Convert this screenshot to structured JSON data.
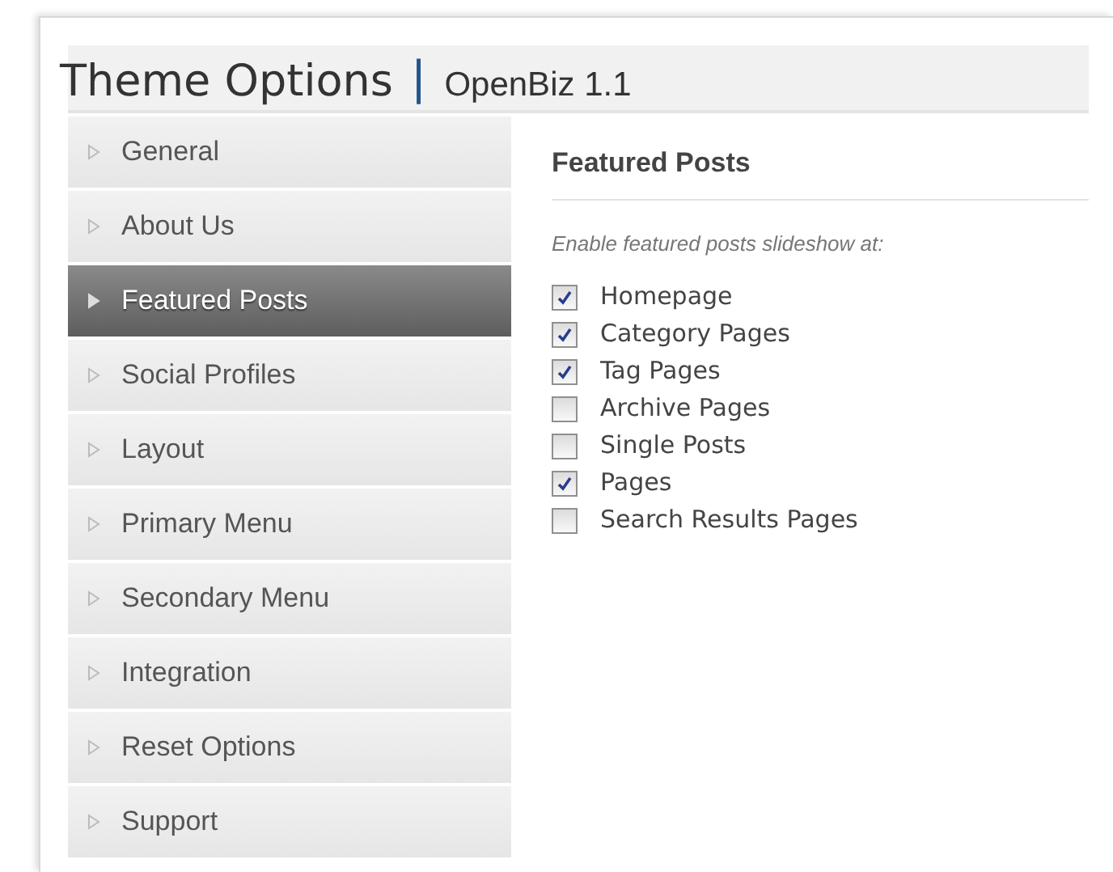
{
  "header": {
    "title": "Theme Options",
    "separator": "|",
    "subtitle": "OpenBiz 1.1"
  },
  "sidebar": {
    "items": [
      {
        "label": "General",
        "selected": false
      },
      {
        "label": "About Us",
        "selected": false
      },
      {
        "label": "Featured Posts",
        "selected": true
      },
      {
        "label": "Social Profiles",
        "selected": false
      },
      {
        "label": "Layout",
        "selected": false
      },
      {
        "label": "Primary Menu",
        "selected": false
      },
      {
        "label": "Secondary Menu",
        "selected": false
      },
      {
        "label": "Integration",
        "selected": false
      },
      {
        "label": "Reset Options",
        "selected": false
      },
      {
        "label": "Support",
        "selected": false
      }
    ]
  },
  "panel": {
    "heading": "Featured Posts",
    "description": "Enable featured posts slideshow at:",
    "options": [
      {
        "label": "Homepage",
        "checked": true
      },
      {
        "label": "Category Pages",
        "checked": true
      },
      {
        "label": "Tag Pages",
        "checked": true
      },
      {
        "label": "Archive Pages",
        "checked": false
      },
      {
        "label": "Single Posts",
        "checked": false
      },
      {
        "label": "Pages",
        "checked": true
      },
      {
        "label": "Search Results Pages",
        "checked": false
      }
    ]
  }
}
